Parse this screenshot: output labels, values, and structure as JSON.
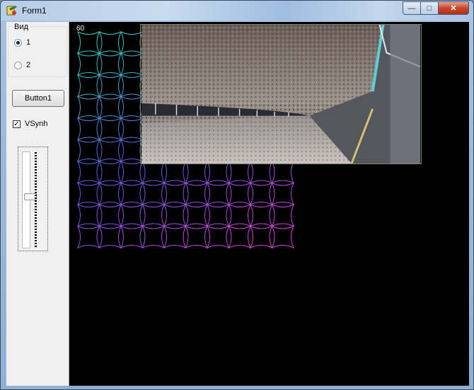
{
  "window": {
    "title": "Form1"
  },
  "caption_buttons": {
    "minimize": "—",
    "maximize": "□",
    "close": "✕"
  },
  "panel": {
    "group_label": "Вид",
    "radios": [
      {
        "label": "1",
        "checked": true
      },
      {
        "label": "2",
        "checked": false
      }
    ],
    "button_label": "Button1",
    "vsync_label": "VSynh",
    "vsync_checked": true,
    "slider_level": 0.46
  },
  "canvas": {
    "fps": "60"
  },
  "colors": {
    "pattern_start": "#2fd0c0",
    "pattern_mid": "#5a5ad8",
    "pattern_end": "#e040d8",
    "canvas_bg": "#000000"
  },
  "icons": [
    "app-icon",
    "minimize-icon",
    "maximize-icon",
    "close-icon"
  ]
}
